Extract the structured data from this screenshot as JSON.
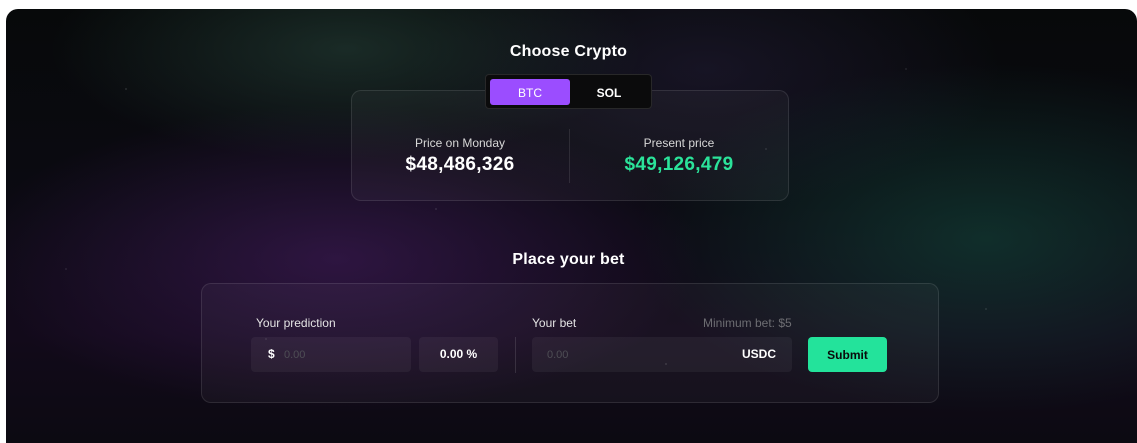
{
  "crypto_section": {
    "title": "Choose Crypto",
    "options": [
      "BTC",
      "SOL"
    ],
    "selected": "BTC",
    "price_monday_label": "Price on Monday",
    "price_monday_value": "$48,486,326",
    "present_price_label": "Present price",
    "present_price_value": "$49,126,479"
  },
  "bet_section": {
    "title": "Place your bet",
    "prediction_label": "Your prediction",
    "prediction_prefix": "$",
    "prediction_placeholder": "0.00",
    "percent_value": "0.00 %",
    "bet_label": "Your bet",
    "minimum_bet": "Minimum bet: $5",
    "bet_placeholder": "0.00",
    "currency": "USDC",
    "submit_label": "Submit"
  },
  "colors": {
    "accent_purple": "#9b4dff",
    "accent_green": "#23e39b",
    "present_price_green": "#2be39a"
  }
}
